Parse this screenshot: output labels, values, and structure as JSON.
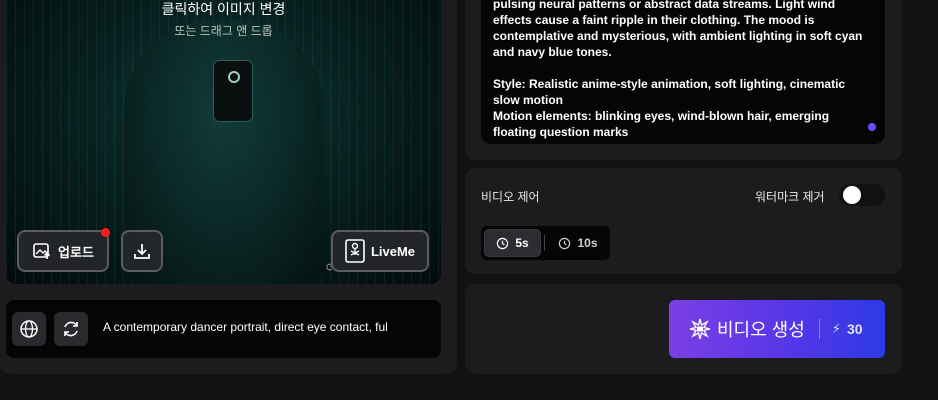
{
  "image_panel": {
    "title": "클릭하여 이미지 변경",
    "subtitle": "또는 드래그 앤 드롭",
    "upload_label": "업로드",
    "liveme_label": "LiveMe"
  },
  "prompt_bar": {
    "text": "A contemporary dancer portrait, direct eye contact, ful"
  },
  "description": {
    "text": "pulsing neural patterns or abstract data streams. Light wind effects cause a faint ripple in their clothing. The mood is contemplative and mysterious, with ambient lighting in soft cyan and navy blue tones.\n\nStyle: Realistic anime-style animation, soft lighting, cinematic slow motion\nMotion elements: blinking eyes, wind-blown hair, emerging floating question marks"
  },
  "video_control": {
    "label": "비디오 제어",
    "watermark_label": "워터마크 제거",
    "watermark_enabled": false,
    "durations": [
      "5s",
      "10s"
    ],
    "selected_duration": "5s"
  },
  "generate": {
    "label": "비디오 생성",
    "cost": "30"
  },
  "colors": {
    "background": "#121214",
    "panel": "#1c1c1f",
    "accent_start": "#7b3fe4",
    "accent_end": "#2d3ae6",
    "notification": "#ff1a1a"
  }
}
